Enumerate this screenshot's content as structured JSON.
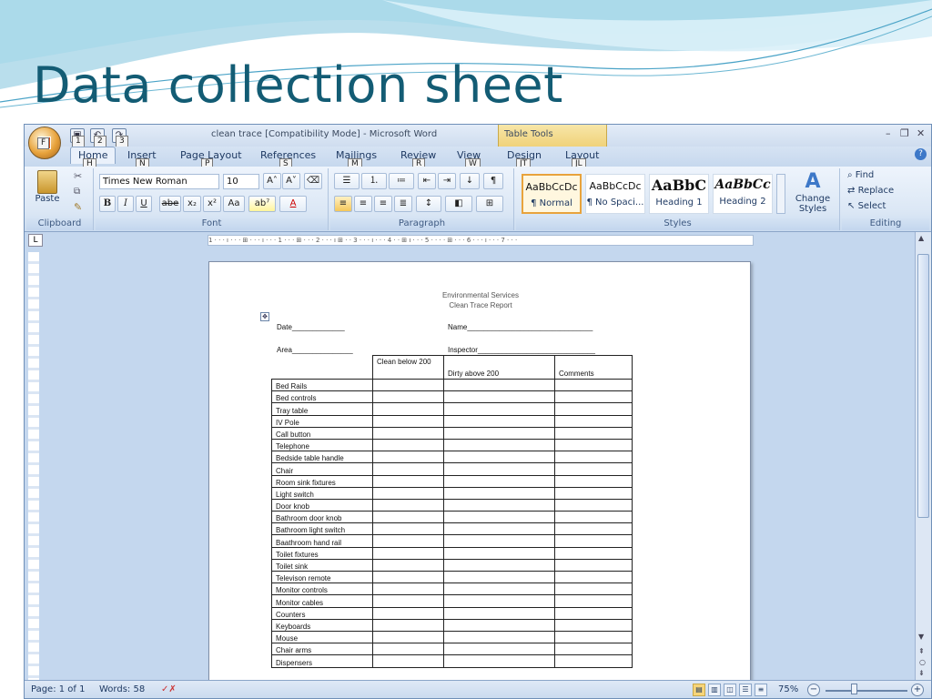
{
  "slide": {
    "title": "Data collection sheet"
  },
  "window": {
    "title": "clean trace [Compatibility Mode] - Microsoft Word",
    "context_tab_group": "Table Tools",
    "quick_access_keys": [
      "1",
      "2",
      "3"
    ],
    "office_button_key": "F"
  },
  "tabs": [
    {
      "label": "Home",
      "key": "H"
    },
    {
      "label": "Insert",
      "key": "N"
    },
    {
      "label": "Page Layout",
      "key": "P"
    },
    {
      "label": "References",
      "key": "S"
    },
    {
      "label": "Mailings",
      "key": "M"
    },
    {
      "label": "Review",
      "key": "R"
    },
    {
      "label": "View",
      "key": "W"
    },
    {
      "label": "Design",
      "key": "JT"
    },
    {
      "label": "Layout",
      "key": "JL"
    }
  ],
  "ribbon": {
    "clipboard": {
      "paste": "Paste",
      "label": "Clipboard"
    },
    "font": {
      "family": "Times New Roman",
      "size": "10",
      "bold": "B",
      "italic": "I",
      "underline": "U",
      "strike": "abe",
      "subscript": "x₂",
      "superscript": "x²",
      "change_case": "Aa",
      "grow": "A˄",
      "shrink": "A˅",
      "label": "Font"
    },
    "paragraph": {
      "label": "Paragraph",
      "pilcrow": "¶"
    },
    "styles": {
      "label": "Styles",
      "tiles": [
        {
          "sample": "AaBbCcDc",
          "name": "¶ Normal"
        },
        {
          "sample": "AaBbCcDc",
          "name": "¶ No Spaci..."
        },
        {
          "sample": "AaBbC",
          "name": "Heading 1"
        },
        {
          "sample": "AaBbCc",
          "name": "Heading 2"
        }
      ],
      "change_styles": "Change Styles"
    },
    "editing": {
      "label": "Editing",
      "find": "Find",
      "replace": "Replace",
      "select": "Select"
    }
  },
  "ruler": {
    "text": "1 · · · ı · · · ⊞ · · · ı · · · 1 · · · ⊞ · · · 2 · · · ı ⊞ · · 3 · · · ı · · · 4 · · ⊞ ı · · · 5 · · · · ⊞ · · · 6 · · · ı · · · 7 · · ·"
  },
  "document": {
    "header1": "Environmental Services",
    "header2": "Clean Trace Report",
    "date_field": "Date_____________",
    "name_field": "Name_______________________________",
    "area_field": "Area_______________",
    "inspector_field": "Inspector_____________________________",
    "table": {
      "headers": [
        "",
        "Clean below 200",
        "Dirty above 200",
        "Comments"
      ],
      "rows": [
        "Bed Rails",
        "Bed controls",
        "Tray table",
        "IV Pole",
        "Call button",
        "Telephone",
        "Bedside table handle",
        "Chair",
        "Room sink fixtures",
        "Light switch",
        "Door knob",
        "Bathroom door knob",
        "Bathroom light switch",
        "Baathroom hand rail",
        "Toilet fixtures",
        "Toilet sink",
        "Televison remote",
        "Monitor controls",
        "Monitor cables",
        "Counters",
        "Keyboards",
        "Mouse",
        "Chair arms",
        "Dispensers"
      ]
    }
  },
  "status": {
    "page": "Page: 1 of 1",
    "words": "Words: 58",
    "zoom": "75%"
  },
  "colors": {
    "title": "#135c74",
    "ribbon": "#dbe7f5",
    "accent": "#e8a33c"
  }
}
